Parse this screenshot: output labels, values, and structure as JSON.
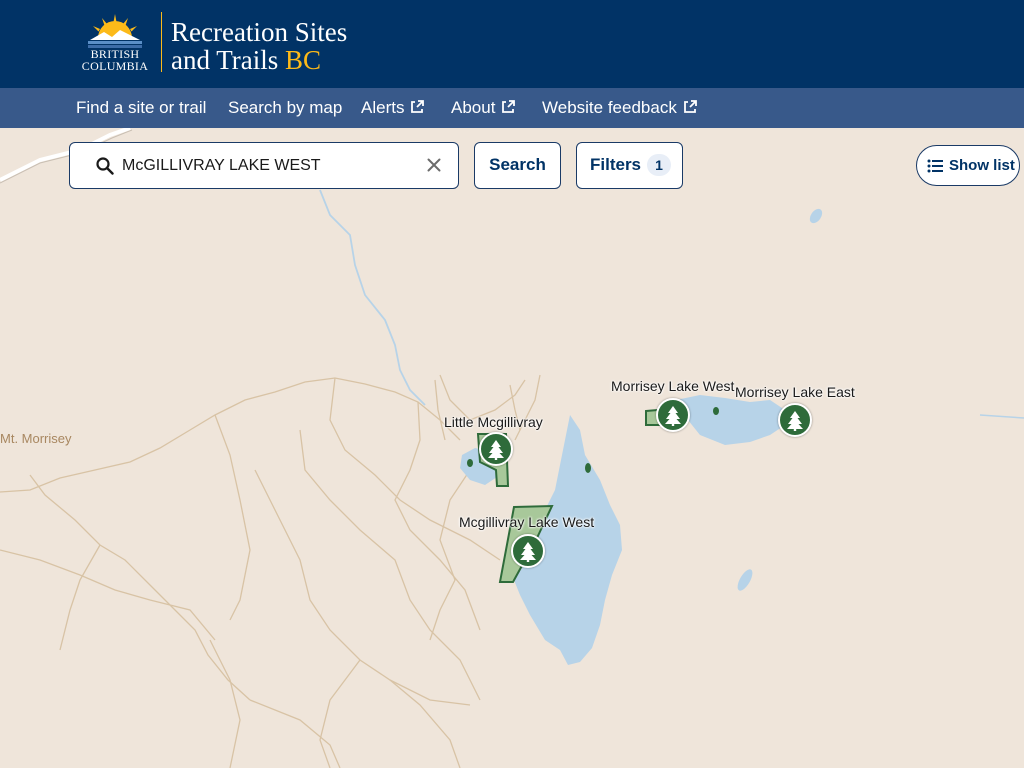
{
  "header": {
    "logo_text_line1": "BRITISH",
    "logo_text_line2": "COLUMBIA",
    "title_line1": "Recreation Sites",
    "title_line2": "and Trails",
    "title_bc": "BC"
  },
  "nav": {
    "items": [
      {
        "label": "Find a site or trail",
        "external": false
      },
      {
        "label": "Search by map",
        "external": false
      },
      {
        "label": "Alerts",
        "external": true
      },
      {
        "label": "About",
        "external": true
      },
      {
        "label": "Website feedback",
        "external": true
      }
    ]
  },
  "search": {
    "value": "McGILLIVRAY LAKE WEST",
    "icon": "search-icon",
    "clear_icon": "close-icon",
    "button_label": "Search"
  },
  "filters": {
    "label": "Filters",
    "count": "1"
  },
  "show_list": {
    "label": "Show list",
    "icon": "list-icon"
  },
  "map": {
    "sites": [
      {
        "name": "Morrisey Lake West"
      },
      {
        "name": "Morrisey Lake East"
      },
      {
        "name": "Little Mcgillivray"
      },
      {
        "name": "Mcgillivray Lake West"
      }
    ],
    "place_labels": [
      "Mt. Morrisey"
    ]
  },
  "colors": {
    "header_bg": "#013366",
    "nav_bg": "#38598a",
    "accent_gold": "#fcba19",
    "map_land": "#efe5da",
    "water": "#b7d3e8",
    "marker": "#2e6b3a",
    "trail": "#d8c3a5"
  }
}
